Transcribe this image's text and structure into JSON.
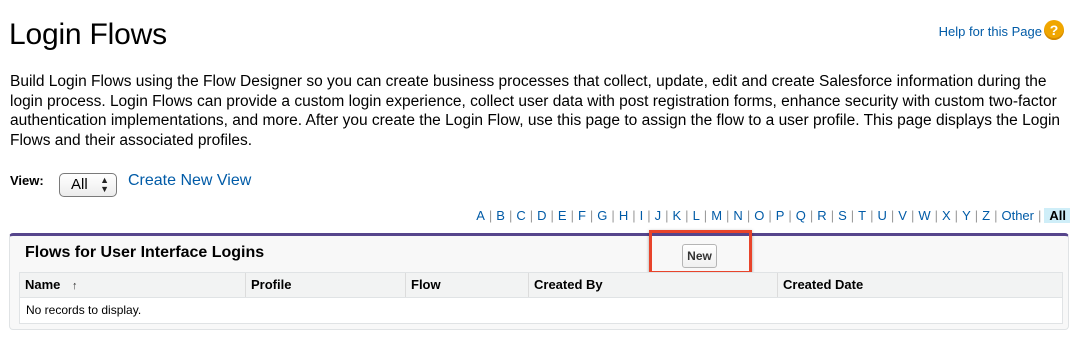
{
  "page": {
    "title": "Login Flows",
    "help_link": "Help for this Page",
    "help_icon": "question-icon",
    "description": "Build Login Flows using the Flow Designer so you can create business processes that collect, update, edit and create Salesforce information during the login process. Login Flows can provide a custom login experience, collect user data with post registration forms, enhance security with custom two-factor authentication implementations, and more. After you create the Login Flow, use this page to assign the flow to a user profile. This page displays the Login Flows and their associated profiles."
  },
  "view": {
    "label": "View:",
    "selected": "All",
    "create_new_view": "Create New View"
  },
  "alphabet": [
    "A",
    "B",
    "C",
    "D",
    "E",
    "F",
    "G",
    "H",
    "I",
    "J",
    "K",
    "L",
    "M",
    "N",
    "O",
    "P",
    "Q",
    "R",
    "S",
    "T",
    "U",
    "V",
    "W",
    "X",
    "Y",
    "Z",
    "Other"
  ],
  "alphabet_active": "All",
  "panel": {
    "title": "Flows for User Interface Logins",
    "new_button": "New",
    "columns": [
      "Name",
      "Profile",
      "Flow",
      "Created By",
      "Created Date"
    ],
    "sort_indicator": "↑",
    "empty_message": "No records to display."
  },
  "colors": {
    "link": "#015ba7",
    "panel_border_top": "#56458c",
    "highlight": "#e8442b",
    "help_icon": "#f0a600",
    "active_letter_bg": "#cfeef8"
  }
}
